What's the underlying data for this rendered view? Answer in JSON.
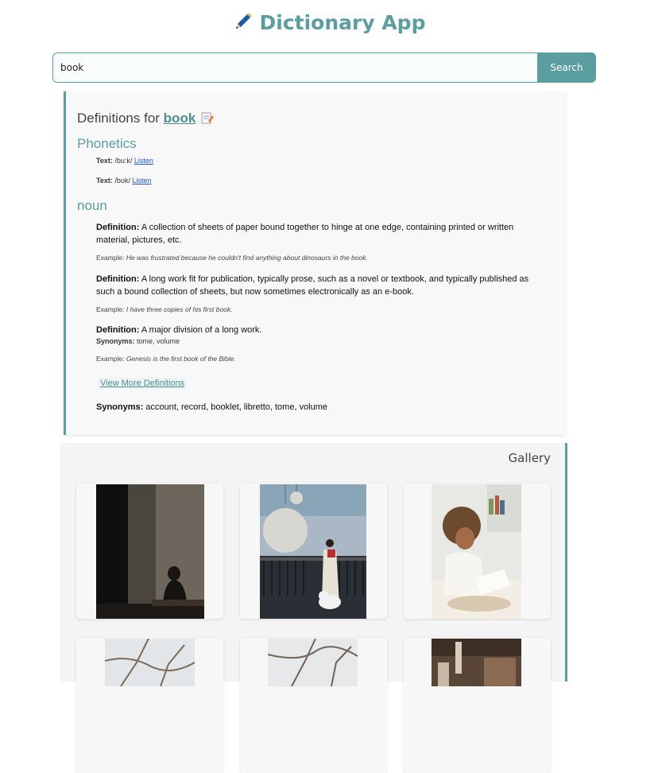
{
  "header": {
    "title": "Dictionary App",
    "icon": "pen-icon"
  },
  "search": {
    "value": "book",
    "button_label": "Search"
  },
  "definitions": {
    "heading_prefix": "Definitions for",
    "word": "book",
    "phonetics_title": "Phonetics",
    "phonetics": [
      {
        "label": "Text:",
        "text": "/bu:k/",
        "link": "Listen"
      },
      {
        "label": "Text:",
        "text": "/bʊk/",
        "link": "Listen"
      }
    ],
    "part_of_speech": "noun",
    "items": [
      {
        "label": "Definition:",
        "text": "A collection of sheets of paper bound together to hinge at one edge, containing printed or written material, pictures, etc.",
        "example_label": "Example:",
        "example": "He was frustrated because he couldn't find anything about dinosaurs in the book."
      },
      {
        "label": "Definition:",
        "text": "A long work fit for publication, typically prose, such as a novel or textbook, and typically published as such a bound collection of sheets, but now sometimes electronically as an e-book.",
        "example_label": "Example:",
        "example": "I have three copies of his first book."
      },
      {
        "label": "Definition:",
        "text": "A major division of a long work.",
        "synonyms_label": "Synonyms:",
        "synonyms": "tome, volume",
        "example_label": "Example:",
        "example": "Genesis is the first book of the Bible."
      }
    ],
    "view_more": "View More Definitions",
    "all_synonyms_label": "Synonyms:",
    "all_synonyms": "account, record, booklet, libretto, tome, volume"
  },
  "gallery": {
    "title": "Gallery",
    "images": [
      {
        "name": "photo-person-reading-dark-room"
      },
      {
        "name": "photo-woman-reading-by-pendant-lamp-with-dog"
      },
      {
        "name": "photo-woman-reading-on-bed"
      },
      {
        "name": "photo-tree-branches"
      },
      {
        "name": "photo-tree-branches-sky"
      },
      {
        "name": "photo-bookshelf-room"
      }
    ]
  },
  "colors": {
    "accent": "#5a9ea0",
    "link": "#1a55d6",
    "panel_bg": "#f8f8f8"
  }
}
